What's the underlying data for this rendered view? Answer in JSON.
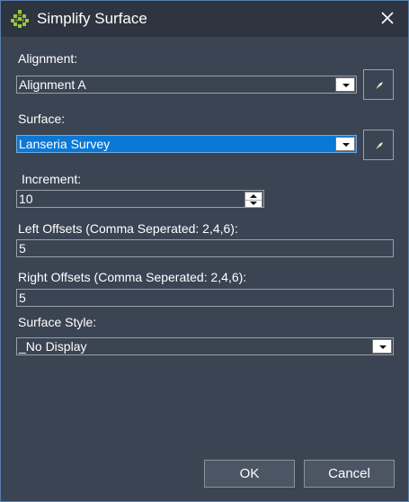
{
  "window": {
    "title": "Simplify Surface",
    "icon": "civil-surface-icon",
    "close_icon": "close-icon"
  },
  "alignment": {
    "label": "Alignment:",
    "value": "Alignment A"
  },
  "surface": {
    "label": "Surface:",
    "value": "Lanseria Survey"
  },
  "increment": {
    "label": "Increment:",
    "value": "10"
  },
  "left_offsets": {
    "label": "Left Offsets (Comma Seperated: 2,4,6):",
    "value": "5"
  },
  "right_offsets": {
    "label": "Right Offsets (Comma Seperated: 2,4,6):",
    "value": "5"
  },
  "surface_style": {
    "label": "Surface Style:",
    "value": "_No Display"
  },
  "buttons": {
    "ok": "OK",
    "cancel": "Cancel"
  },
  "colors": {
    "background": "#3b4453",
    "titlebar": "#2e3440",
    "selection": "#0a78d7",
    "icon_accent": "#9bc83a"
  }
}
